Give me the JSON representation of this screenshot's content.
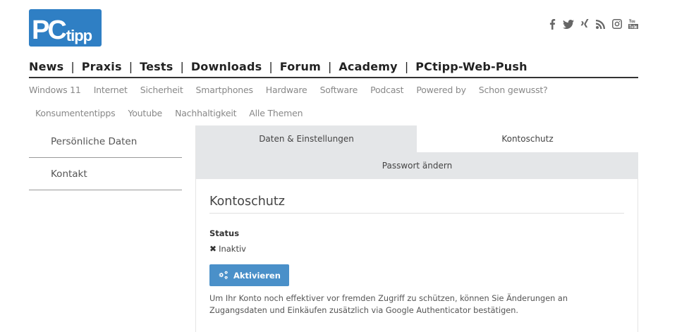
{
  "header": {
    "logo_pc": "PC",
    "logo_tipp": "tipp",
    "social": [
      "facebook-icon",
      "twitter-icon",
      "xing-icon",
      "rss-icon",
      "instagram-icon",
      "youtube-icon"
    ],
    "youtube_text": "You\nTube"
  },
  "mainnav": {
    "items": [
      "News",
      "Praxis",
      "Tests",
      "Downloads",
      "Forum",
      "Academy",
      "PCtipp-Web-Push"
    ],
    "separator": "|"
  },
  "subnav": {
    "row1": [
      "Windows 11",
      "Internet",
      "Sicherheit",
      "Smartphones",
      "Hardware",
      "Software",
      "Podcast",
      "Powered by",
      "Schon gewusst?"
    ],
    "row2": [
      "Konsumententipps",
      "Youtube",
      "Nachhaltigkeit",
      "Alle Themen"
    ]
  },
  "leftmenu": {
    "items": [
      "Persönliche Daten",
      "Kontakt"
    ]
  },
  "tabs": {
    "data_settings": "Daten & Einstellungen",
    "account_protection": "Kontoschutz",
    "change_password": "Passwort ändern"
  },
  "content": {
    "heading": "Kontoschutz",
    "status_label": "Status",
    "status_icon": "✖",
    "status_value": "Inaktiv",
    "activate_button": "Aktivieren",
    "description": "Um Ihr Konto noch effektiver vor fremden Zugriff zu schützen, können Sie Änderungen an Zugangsdaten und Einkäufen zusätzlich via Google Authenticator bestätigen."
  },
  "colors": {
    "logo_bg": "#2f7fc4",
    "button_bg": "#4a90c9",
    "tab_inactive_bg": "#e4e6e8"
  }
}
